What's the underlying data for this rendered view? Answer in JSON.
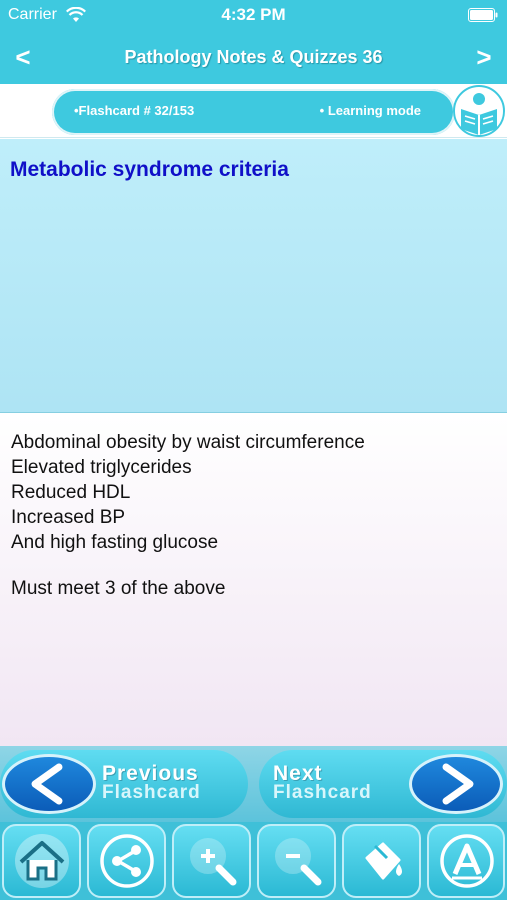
{
  "status_bar": {
    "carrier": "Carrier",
    "time": "4:32 PM"
  },
  "nav": {
    "back_glyph": "<",
    "title": "Pathology Notes & Quizzes 36",
    "forward_glyph": ">"
  },
  "info": {
    "card_label": "•Flashcard #  32/153",
    "mode_label": "• Learning mode",
    "icon": "reader-book-icon"
  },
  "question": {
    "title": "Metabolic syndrome criteria"
  },
  "answer": {
    "lines": [
      "Abdominal obesity by waist circumference",
      "Elevated triglycerides",
      "Reduced HDL",
      "Increased BP",
      "And high fasting glucose"
    ],
    "note": "Must meet 3 of the above"
  },
  "flash_nav": {
    "previous": {
      "line1": "Previous",
      "line2": "Flashcard"
    },
    "next": {
      "line1": "Next",
      "line2": "Flashcard"
    }
  },
  "toolbar": {
    "buttons": [
      "home-icon",
      "share-icon",
      "zoom-in-icon",
      "zoom-out-icon",
      "paint-bucket-icon",
      "font-icon"
    ]
  },
  "colors": {
    "accent": "#3ec9df",
    "question_text": "#1010c8",
    "question_bg": "#bfeefa",
    "answer_bg": "#ffffff"
  }
}
